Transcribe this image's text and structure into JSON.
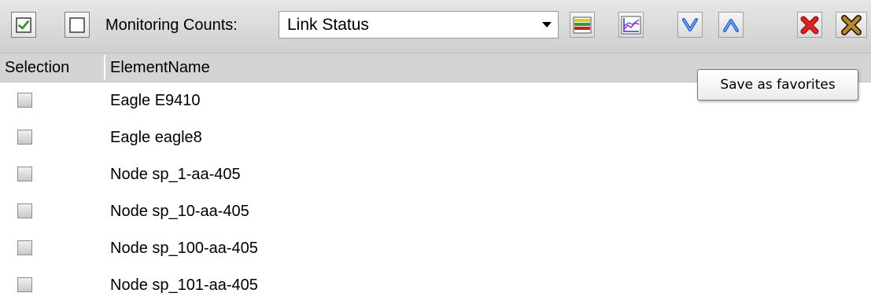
{
  "toolbar": {
    "select_all_icon": "checkbox-checked-icon",
    "deselect_all_icon": "checkbox-empty-icon",
    "monitoring_label": "Monitoring Counts:",
    "monitoring_select_value": "Link Status",
    "buttons": [
      {
        "name": "color-bars-icon"
      },
      {
        "name": "line-chart-icon"
      },
      {
        "name": "expand-down-icon"
      },
      {
        "name": "collapse-up-icon"
      },
      {
        "name": "red-x-delete-icon"
      },
      {
        "name": "brown-x-close-icon"
      }
    ]
  },
  "table": {
    "columns": [
      "Selection",
      "ElementName"
    ],
    "rows": [
      {
        "selected": false,
        "name": "Eagle E9410"
      },
      {
        "selected": false,
        "name": "Eagle eagle8"
      },
      {
        "selected": false,
        "name": "Node sp_1-aa-405"
      },
      {
        "selected": false,
        "name": "Node sp_10-aa-405"
      },
      {
        "selected": false,
        "name": "Node sp_100-aa-405"
      },
      {
        "selected": false,
        "name": "Node sp_101-aa-405"
      }
    ]
  },
  "tooltip": {
    "text": "Save as favorites"
  },
  "colors": {
    "toolbar_bg": "#d9d9d9",
    "header_bg": "#d4d4d4",
    "checkmark_green": "#1e9a1e",
    "arrow_blue": "#2563d6",
    "delete_red": "#d11a1a",
    "close_brown": "#6a4a1a"
  }
}
